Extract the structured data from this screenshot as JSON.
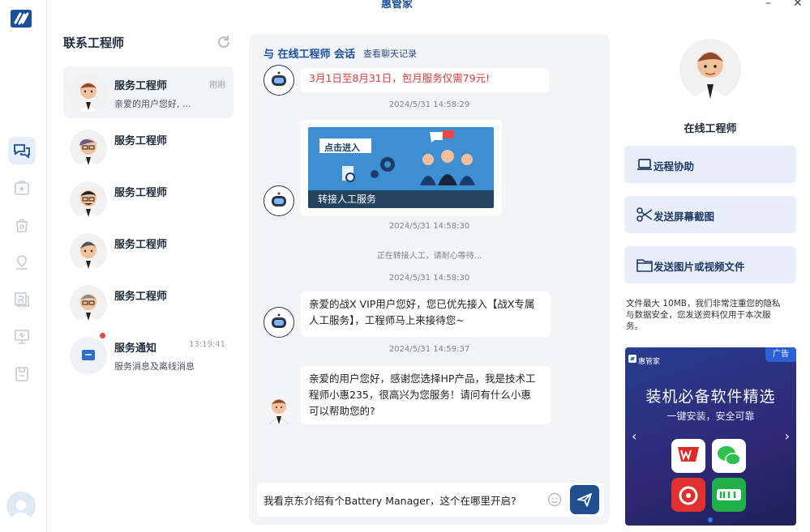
{
  "window": {
    "title": "惠管家",
    "minimize": "–",
    "close": "✕"
  },
  "rail": {
    "items": [
      {
        "name": "chat-icon",
        "active": true
      },
      {
        "name": "medkit-icon",
        "active": false
      },
      {
        "name": "bag-icon",
        "active": false
      },
      {
        "name": "location-icon",
        "active": false
      },
      {
        "name": "register-icon",
        "active": false
      },
      {
        "name": "monitor-icon",
        "active": false
      },
      {
        "name": "save-icon",
        "active": false
      }
    ]
  },
  "contacts": {
    "title": "联系工程师",
    "items": [
      {
        "name": "服务工程师",
        "time": "刚刚",
        "preview": "亲爱的用户您好, ..."
      },
      {
        "name": "服务工程师",
        "time": "",
        "preview": ""
      },
      {
        "name": "服务工程师",
        "time": "",
        "preview": ""
      },
      {
        "name": "服务工程师",
        "time": "",
        "preview": ""
      },
      {
        "name": "服务工程师",
        "time": "",
        "preview": ""
      },
      {
        "name": "服务通知",
        "time": "13:19:41",
        "preview": "服务消息及离线消息"
      }
    ]
  },
  "chat": {
    "title": "与 在线工程师 会话",
    "history_link": "查看聊天记录",
    "msg_top": "3月1日至8月31日，包月服务仅需79元!",
    "ts1": "2024/5/31 14:58:29",
    "banner_button": "点击进入",
    "banner_caption": "转接人工服务",
    "ts2": "2024/5/31 14:58:30",
    "system_notice": "正在转接人工，请耐心等待...",
    "ts3": "2024/5/31 14:58:30",
    "msg_vip_line1": "亲爱的战X VIP用户您好，您已优先接入【战X专属",
    "msg_vip_line2": "人工服务】，工程师马上来接待您~",
    "ts4": "2024/5/31 14:59:37",
    "msg_eng_line1": "亲爱的用户您好，感谢您选择HP产品，我是技术工",
    "msg_eng_line2": "程师小惠235，很高兴为您服务！请问有什么小惠",
    "msg_eng_line3": "可以帮助您的?",
    "input_value": "我看京东介绍有个Battery Manager，这个在哪里开启?"
  },
  "right": {
    "engineer_name": "在线工程师",
    "actions": {
      "remote": "远程协助",
      "screenshot": "发送屏幕截图",
      "file": "发送图片或视频文件"
    },
    "note_line1": "文件最大 10MB，我们非常注重您的隐私",
    "note_line2": "与数据安全，您发送资料仅用于本次服",
    "note_line3": "务。",
    "ad": {
      "tag": "广告",
      "brand": "惠管家",
      "headline": "装机必备软件精选",
      "subhead": "一键安装，安全可靠",
      "apps": [
        "WPS",
        "WeChat",
        "NetEase Music",
        "iQIYI"
      ]
    }
  },
  "colors": {
    "accent": "#1d4f91",
    "title_blue": "#1a4f9c",
    "promo_red": "#d93a3a",
    "notify_red": "#e84848"
  }
}
